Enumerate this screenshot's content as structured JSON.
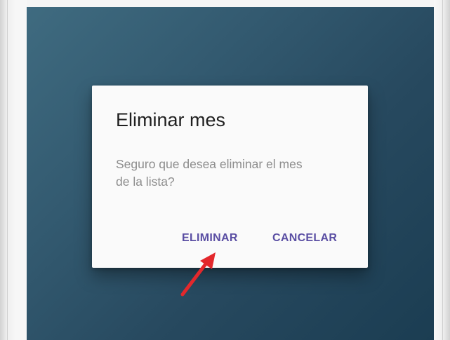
{
  "dialog": {
    "title": "Eliminar mes",
    "message_line1": "Seguro que desea eliminar el mes",
    "message_line2": "de la lista?",
    "delete_label": "ELIMINAR",
    "cancel_label": "CANCELAR"
  },
  "colors": {
    "screen_background": "#2d5066",
    "dialog_background": "#fafafa",
    "title_text": "#1f1f1f",
    "message_text": "#8d8d8d",
    "button_text": "#5a4ea3",
    "annotation_arrow": "#e3282c"
  },
  "icons": {
    "annotation": "red-arrow-icon"
  }
}
